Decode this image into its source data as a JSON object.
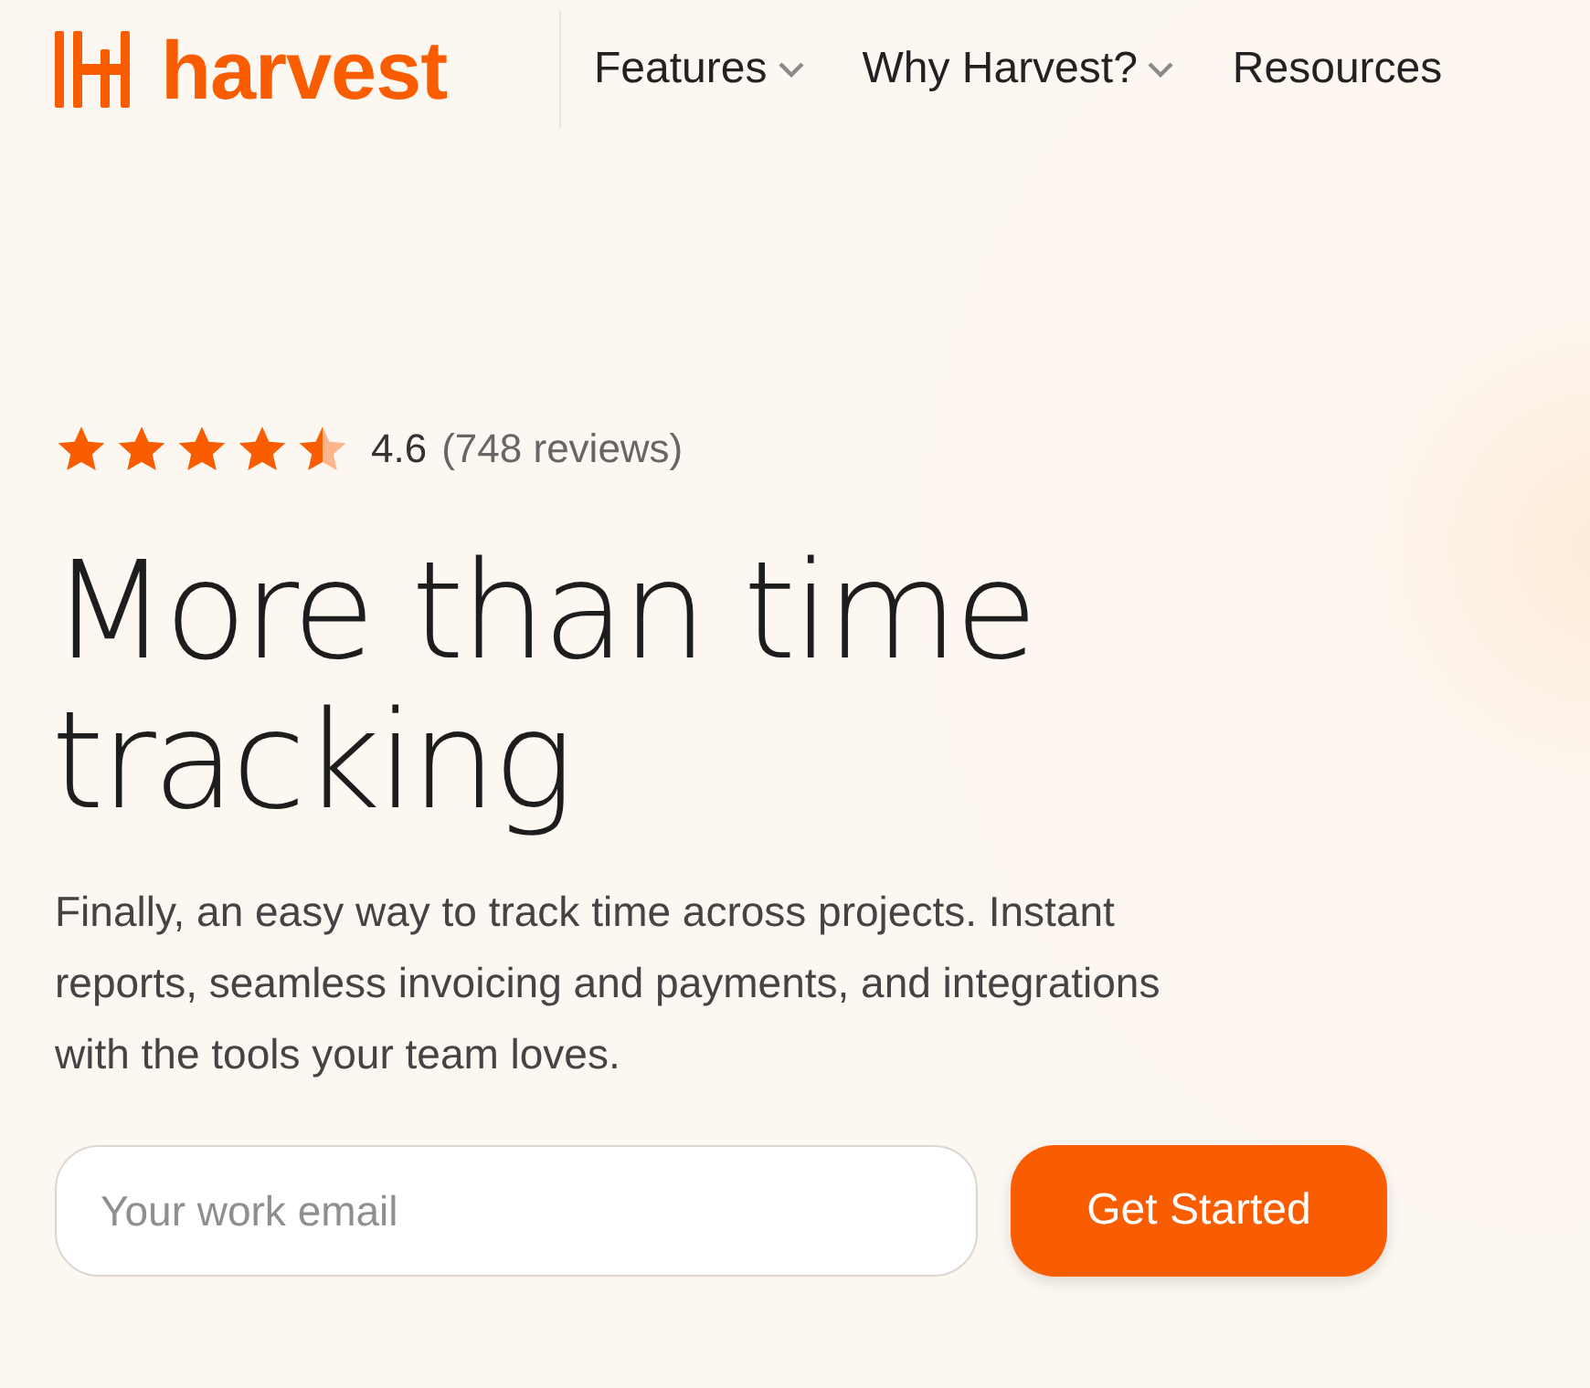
{
  "header": {
    "logo": "harvest",
    "nav": [
      {
        "label": "Features",
        "dropdown": true
      },
      {
        "label": "Why Harvest?",
        "dropdown": true
      },
      {
        "label": "Resources",
        "dropdown": false
      }
    ]
  },
  "rating": {
    "stars": 4.5,
    "score": "4.6",
    "reviews": "(748 reviews)"
  },
  "hero": {
    "title": "More than time tracking",
    "description": "Finally, an easy way to track time across projects. Instant reports, seamless invoicing and payments, and integrations with the tools your team loves."
  },
  "signup": {
    "placeholder": "Your work email",
    "button": "Get Started"
  }
}
